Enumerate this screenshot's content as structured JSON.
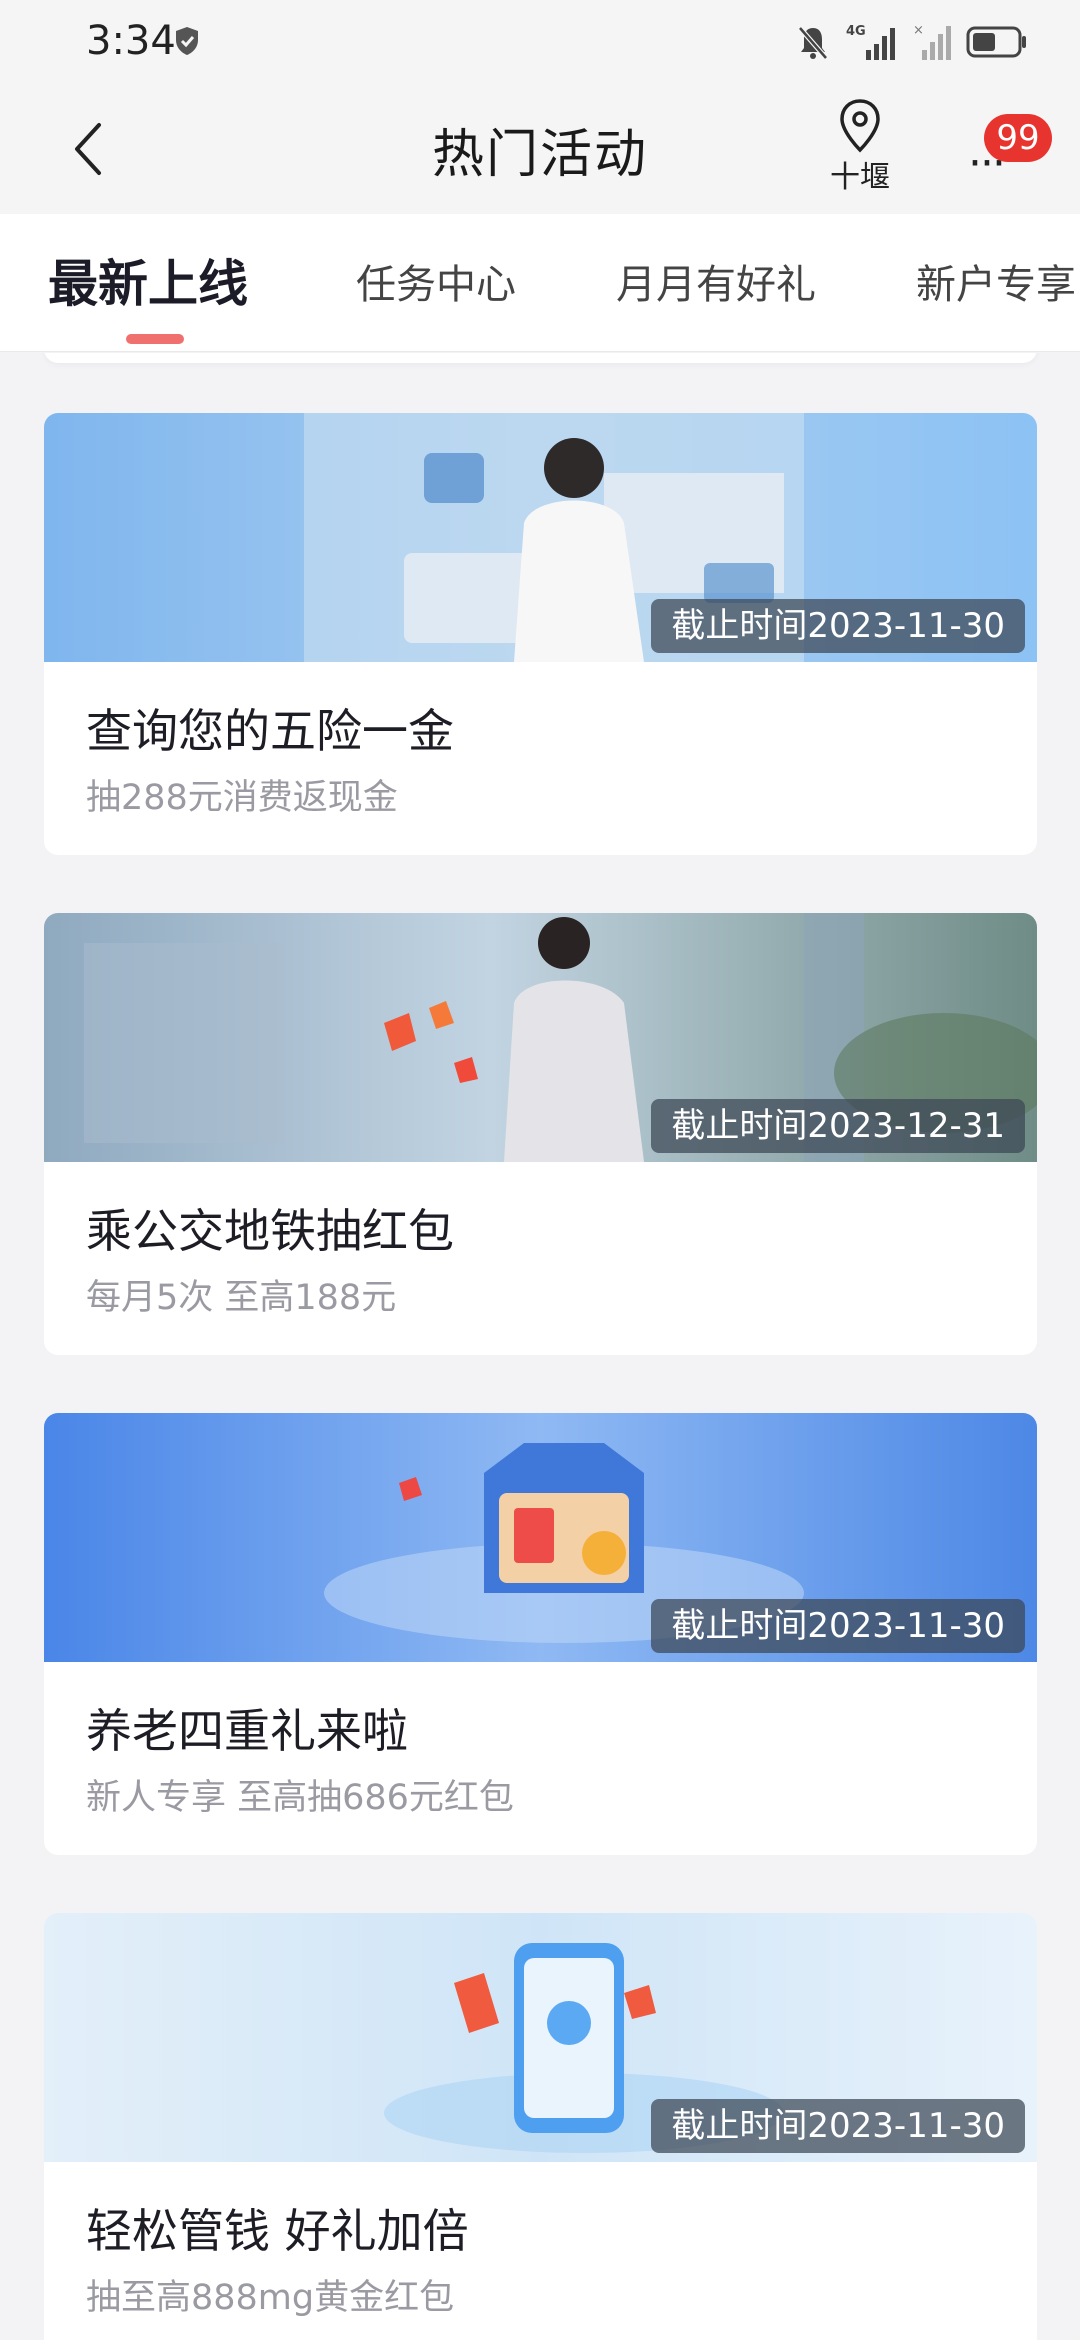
{
  "status_bar": {
    "time": "3:34",
    "network": "4G"
  },
  "header": {
    "title": "热门活动",
    "location": "十堰",
    "more_badge": "99",
    "more_label": "···"
  },
  "tabs": [
    {
      "label": "最新上线",
      "active": true
    },
    {
      "label": "任务中心",
      "active": false
    },
    {
      "label": "月月有好礼",
      "active": false
    },
    {
      "label": "新户专享",
      "active": false
    }
  ],
  "cards": [
    {
      "deadline": "截止时间2023-11-30",
      "title": "查询您的五险一金",
      "subtitle": "抽288元消费返现金"
    },
    {
      "deadline": "截止时间2023-12-31",
      "title": "乘公交地铁抽红包",
      "subtitle": "每月5次 至高188元"
    },
    {
      "deadline": "截止时间2023-11-30",
      "title": "养老四重礼来啦",
      "subtitle": "新人专享 至高抽686元红包"
    },
    {
      "deadline": "截止时间2023-11-30",
      "title": "轻松管钱 好礼加倍",
      "subtitle": "抽至高888mg黄金红包"
    }
  ],
  "colors": {
    "accent": "#e8342f",
    "tab_indicator": "#f07070",
    "page_bg": "#f3f3f5"
  }
}
